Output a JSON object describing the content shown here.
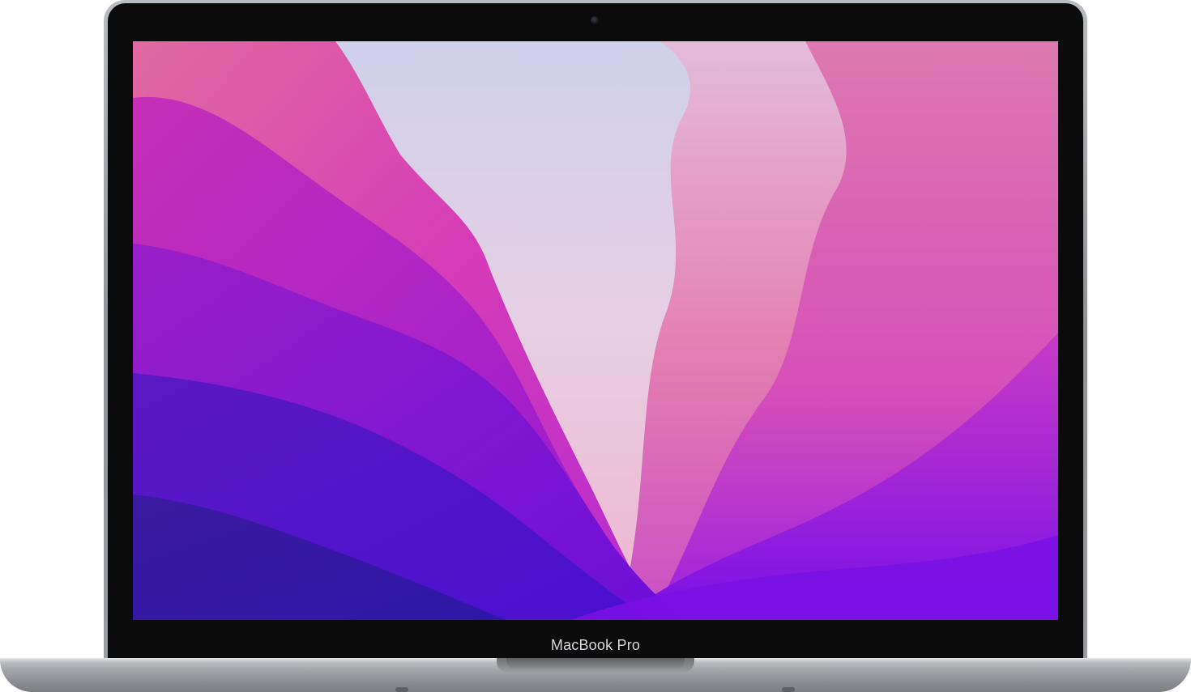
{
  "device": {
    "chin_label": "MacBook Pro",
    "icons": [
      "camera-icon"
    ]
  },
  "wallpaper": {
    "colors": {
      "deep_purple": "#3a1aa0",
      "violet": "#6a12d8",
      "magenta": "#d63bb8",
      "pink": "#e46aa8",
      "lavender": "#c9c4ea",
      "mist": "#e8d4e4"
    }
  }
}
